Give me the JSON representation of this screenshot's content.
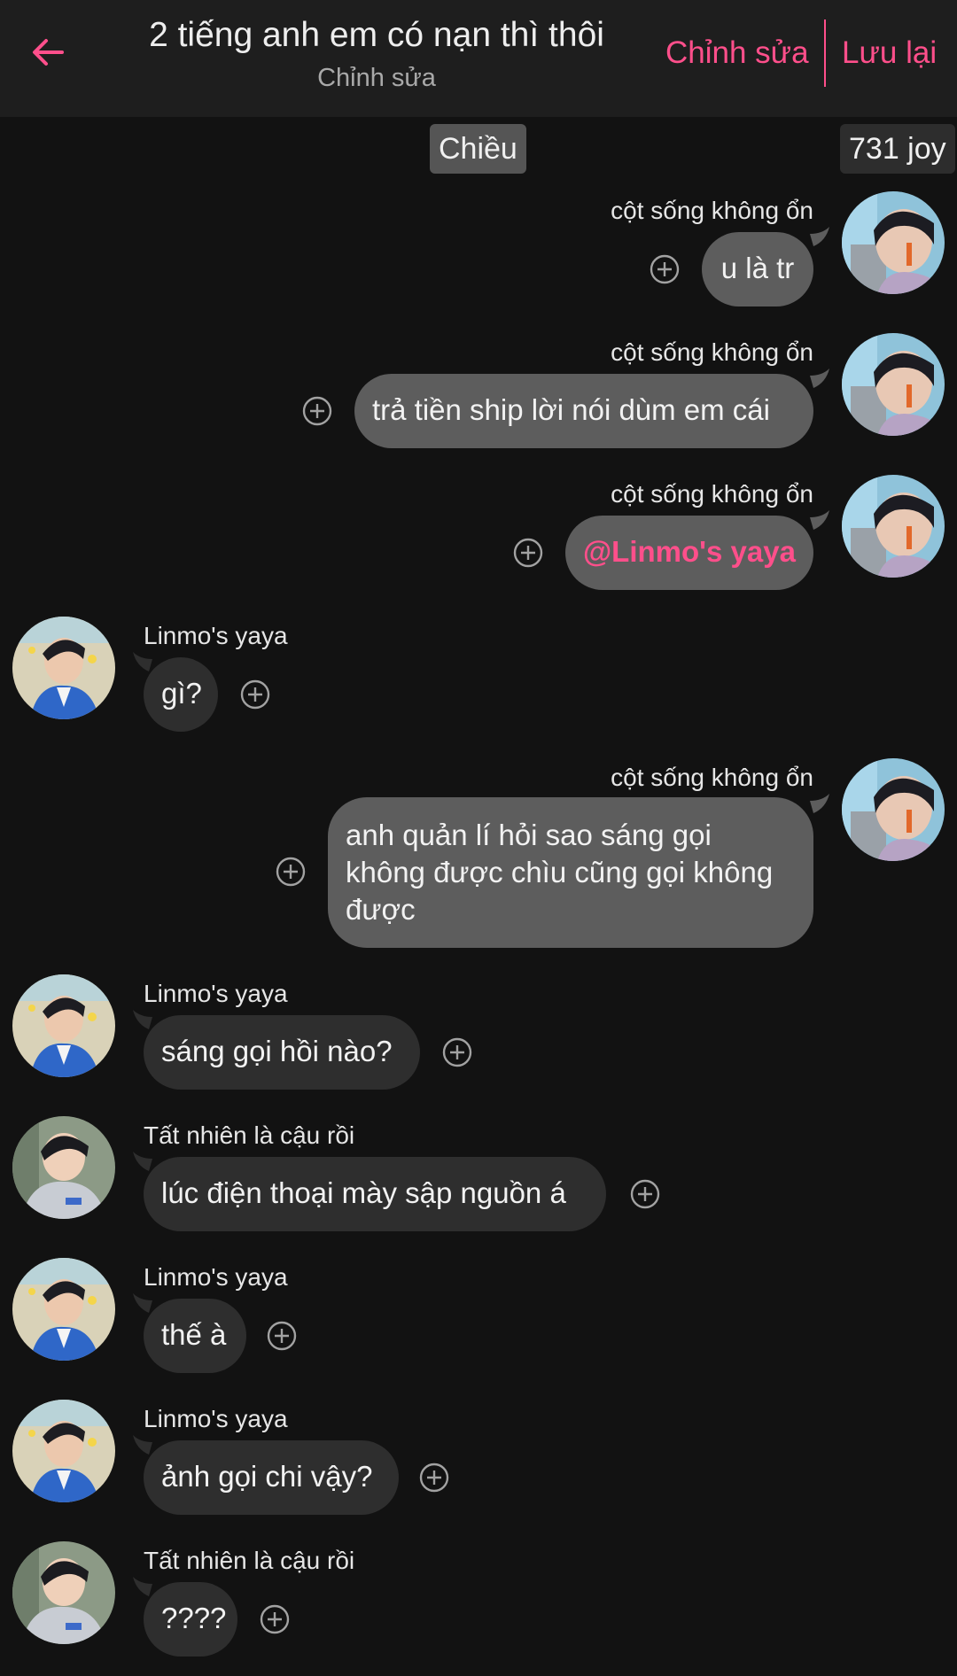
{
  "header": {
    "title": "2 tiếng anh em có nạn thì thôi",
    "subtitle": "Chỉnh sửa",
    "edit_label": "Chỉnh sửa",
    "save_label": "Lưu lại"
  },
  "chips": {
    "time": "Chiều",
    "joy": "731 joy"
  },
  "messages": [
    {
      "sender": "cột sống không ổn",
      "text": "u là tr"
    },
    {
      "sender": "cột sống không ổn",
      "text": "trả tiền ship lời nói dùm em cái"
    },
    {
      "sender": "cột sống không ổn",
      "text": "@Linmo's yaya"
    },
    {
      "sender": "Linmo's yaya",
      "text": "gì?"
    },
    {
      "sender": "cột sống không ổn",
      "text": "anh quản lí hỏi sao sáng gọi không được chìu cũng gọi không được"
    },
    {
      "sender": "Linmo's yaya",
      "text": "sáng gọi hồi nào?"
    },
    {
      "sender": "Tất nhiên là cậu rồi",
      "text": "lúc điện thoại mày sập nguồn á"
    },
    {
      "sender": "Linmo's yaya",
      "text": "thế à"
    },
    {
      "sender": "Linmo's yaya",
      "text": "ảnh gọi chi vậy?"
    },
    {
      "sender": "Tất nhiên là cậu rồi",
      "text": "????"
    }
  ],
  "colors": {
    "accent": "#ff4f8b",
    "own_bubble": "#5d5d5d",
    "other_bubble": "#2e2e2e",
    "background": "#121212"
  },
  "icons": {
    "back": "arrow-left-icon",
    "add": "add-reaction-icon"
  }
}
